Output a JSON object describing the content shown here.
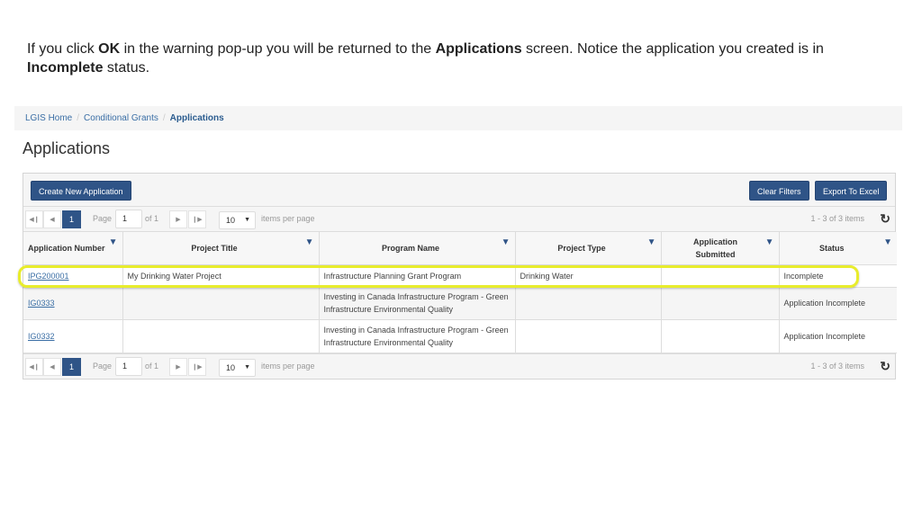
{
  "instruction": {
    "part1": "If you click ",
    "bold1": "OK",
    "part2": " in the warning pop-up you will be returned to the ",
    "bold2": "Applications",
    "part3": " screen. Notice the application you created is in ",
    "bold3": "Incomplete",
    "part4": " status."
  },
  "breadcrumb": {
    "items": [
      "LGIS Home",
      "Conditional Grants"
    ],
    "active": "Applications",
    "separator": "/"
  },
  "page_title": "Applications",
  "toolbar": {
    "create_label": "Create New Application",
    "clear_filters_label": "Clear Filters",
    "export_label": "Export To Excel"
  },
  "pager": {
    "first_icon": "first-page-icon",
    "prev_icon": "prev-page-icon",
    "current_page": "1",
    "page_label": "Page",
    "page_value": "1",
    "of_label": "of 1",
    "next_icon": "next-page-icon",
    "last_icon": "last-page-icon",
    "page_size": "10",
    "items_per_page_label": "items per page",
    "info": "1 - 3 of 3 items",
    "refresh_icon": "refresh-icon"
  },
  "table": {
    "columns": [
      {
        "label": "Application Number",
        "filter_icon": "filter-icon"
      },
      {
        "label": "Project Title",
        "filter_icon": "filter-icon"
      },
      {
        "label": "Program Name",
        "filter_icon": "filter-icon"
      },
      {
        "label": "Project Type",
        "filter_icon": "filter-icon"
      },
      {
        "label": "Application Submitted",
        "filter_icon": "filter-icon"
      },
      {
        "label": "Status",
        "filter_icon": "filter-icon"
      }
    ],
    "rows": [
      {
        "application_number": "IPG200001",
        "project_title": "My Drinking Water Project",
        "program_name": "Infrastructure Planning Grant Program",
        "project_type": "Drinking Water",
        "application_submitted": "",
        "status": "Incomplete"
      },
      {
        "application_number": "IG0333",
        "project_title": "",
        "program_name": "Investing in Canada Infrastructure Program - Green Infrastructure Environmental Quality",
        "project_type": "",
        "application_submitted": "",
        "status": "Application Incomplete"
      },
      {
        "application_number": "IG0332",
        "project_title": "",
        "program_name": "Investing in Canada Infrastructure Program - Green Infrastructure Environmental Quality",
        "project_type": "",
        "application_submitted": "",
        "status": "Application Incomplete"
      }
    ]
  },
  "colors": {
    "primary": "#2f5487",
    "link": "#3a6ea5",
    "highlight": "#e8ec2c"
  }
}
